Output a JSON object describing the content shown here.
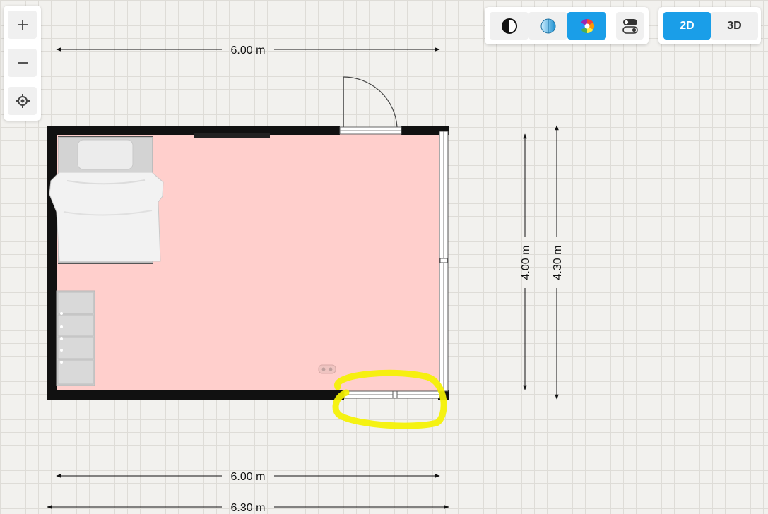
{
  "app": {
    "accent_color": "#1a9ee8",
    "room_fill_color": "#ffcfcc",
    "highlight_color": "#f5f200"
  },
  "zoom_controls": {
    "zoom_in_icon": "plus-icon",
    "zoom_out_icon": "minus-icon",
    "recenter_icon": "crosshair-icon"
  },
  "toolbar": {
    "buttons": [
      {
        "icon": "contrast-icon",
        "active": false
      },
      {
        "icon": "gradient-icon",
        "active": false
      },
      {
        "icon": "color-wheel-icon",
        "active": true
      },
      {
        "icon": "toggle-settings-icon",
        "active": false
      }
    ]
  },
  "view_toggle": {
    "label_2d": "2D",
    "label_3d": "3D",
    "selected": "2D"
  },
  "dimensions": {
    "top_inner_width": "6.00 m",
    "bottom_inner_width": "6.00 m",
    "bottom_outer_width": "6.30 m",
    "right_inner_height": "4.00 m",
    "right_outer_height": "4.30 m"
  }
}
